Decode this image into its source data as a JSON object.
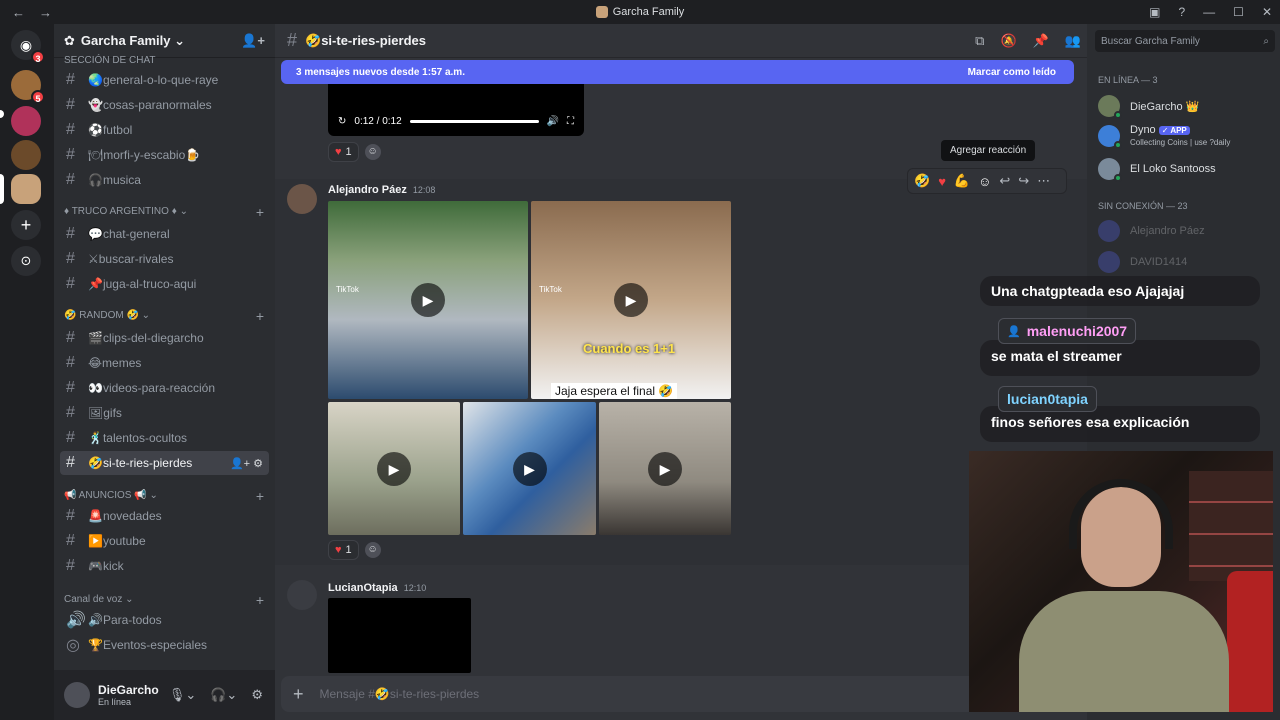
{
  "window": {
    "title": "Garcha Family",
    "nav_back": "←",
    "nav_fwd": "→"
  },
  "servers": {
    "badge1": "3",
    "badge2": "5"
  },
  "guild": {
    "name": "Garcha Family ⌄"
  },
  "channels": {
    "section1_label": "SECCIÓN DE CHAT",
    "items_top": [
      "🌏general-o-lo-que-raye",
      "👻cosas-paranormales",
      "⚽futbol",
      "🍽morfi-y-escabio🍺",
      "🎧musica"
    ],
    "cat_truco": "♦ TRUCO ARGENTINO ♦ ⌄",
    "items_truco": [
      "💬chat-general",
      "⚔buscar-rivales",
      "📌juga-al-truco-aqui"
    ],
    "cat_random": "🤣 RANDOM 🤣 ⌄",
    "items_random": [
      "🎬clips-del-diegarcho",
      "😂memes",
      "👀videos-para-reacción",
      "🖼gifs",
      "🕺talentos-ocultos",
      "🤣si-te-ries-pierdes"
    ],
    "cat_anuncios": "📢 ANUNCIOS 📢 ⌄",
    "items_anuncios": [
      "🚨novedades",
      "▶️youtube",
      "🎮kick"
    ],
    "cat_voz": "Canal de voz ⌄",
    "items_voz": [
      "🔊Para-todos",
      "🏆Eventos-especiales"
    ]
  },
  "user": {
    "name": "DieGarcho",
    "status": "En línea"
  },
  "header": {
    "channel": "🤣si-te-ries-pierdes"
  },
  "newbar": {
    "text": "3 mensajes nuevos desde 1:57 a.m.",
    "mark": "Marcar como leído"
  },
  "player": {
    "time": "0:12 / 0:12"
  },
  "reactions": {
    "first_count": "1",
    "second_count": "1"
  },
  "tooltip": {
    "text": "Agregar reacción"
  },
  "message1": {
    "author": "Alejandro Páez",
    "time": "12:08",
    "tiktok1": "TikTok",
    "tiktok2": "TikTok",
    "caption_cuando": "Cuando es 1+1",
    "caption_jaja": "Jaja espera el final 🤣"
  },
  "message2": {
    "author": "LucianOtapia",
    "time": "12:10"
  },
  "composer": {
    "placeholder": "Mensaje #🤣si-te-ries-pierdes"
  },
  "members": {
    "search_placeholder": "Buscar Garcha Family",
    "online_header": "En línea — 3",
    "online": [
      {
        "name": "DieGarcho 👑"
      },
      {
        "name": "Dyno",
        "tag": "✓ APP",
        "sub": "Collecting Coins | use ?daily"
      },
      {
        "name": "El Loko Santooss"
      }
    ],
    "offline_header": "Sin conexión — 23",
    "offline": [
      "Alejandro Páez",
      "DAVID1414"
    ]
  },
  "stream_chat": {
    "line0": "Una chatgpteada eso Ajajajaj",
    "name1": "malenuchi2007",
    "line1": "se mata el streamer",
    "name2": "lucian0tapia",
    "line2": "finos señores esa explicación"
  },
  "colors": {
    "blurple": "#5865f2",
    "bg_main": "#313338",
    "bg_side": "#2b2d31",
    "heart": "#f23f43"
  }
}
